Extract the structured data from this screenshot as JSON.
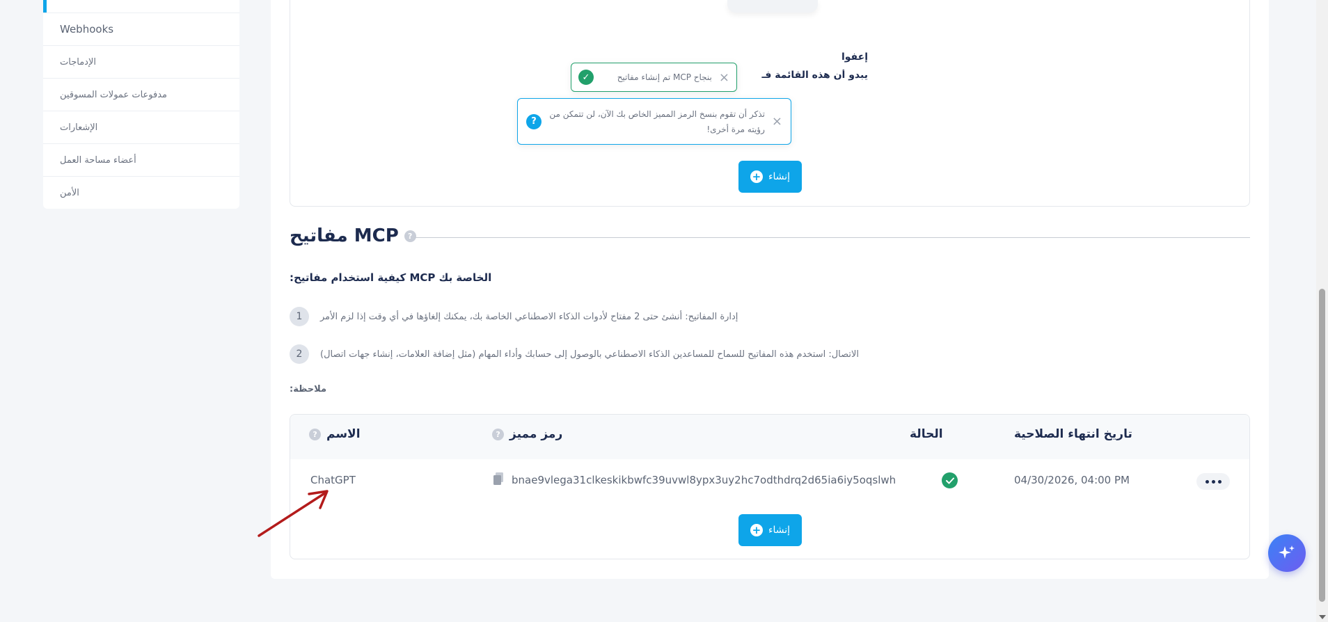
{
  "sidebar": {
    "active_label": "",
    "items": [
      {
        "label": "Webhooks"
      },
      {
        "label": "الإدماجات"
      },
      {
        "label": "مدفوعات عمولات المسوقين"
      },
      {
        "label": "الإشعارات"
      },
      {
        "label": "أعضاء مساحة العمل"
      },
      {
        "label": "الأمن"
      }
    ]
  },
  "empty_state": {
    "title": "إعفوا",
    "subtitle": "يبدو أن هذه القائمة فـ",
    "create_label": "إنشاء"
  },
  "toasts": {
    "success": "بنجاح MCP تم إنشاء مفاتيح",
    "info": "تذكر أن تقوم بنسخ الرمز المميز الخاص بك الآن، لن تتمكن من رؤيته مرة أخرى!"
  },
  "mcp": {
    "section_title": "مفاتيح MCP",
    "howto_title": "الخاصة بك MCP كيفية استخدام مفاتيح:",
    "steps": [
      {
        "num": "1",
        "text": "إدارة المفاتيح: أنشئ حتى 2 مفتاح لأدوات الذكاء الاصطناعي الخاصة بك، يمكنك إلغاؤها في أي وقت إذا لزم الأمر"
      },
      {
        "num": "2",
        "text": "الاتصال: استخدم هذه المفاتيح للسماح للمساعدين الذكاء الاصطناعي بالوصول إلى حسابك وأداء المهام (مثل إضافة العلامات، إنشاء جهات اتصال)"
      }
    ],
    "note": "ملاحظة:",
    "table": {
      "headers": {
        "name": "الاسم",
        "token": "رمز مميز",
        "status": "الحالة",
        "expiry": "تاريخ انتهاء الصلاحية"
      },
      "rows": [
        {
          "name": "ChatGPT",
          "token": "bnae9vlega31clkeskikbwfc39uvwl8ypx3uy2hc7odthdrq2d65ia6iy5oqslwh",
          "status": "active",
          "expiry": "04/30/2026, 04:00 PM"
        }
      ]
    },
    "create_label": "إنشاء"
  },
  "colors": {
    "accent": "#0ea5e9",
    "success": "#22a06b",
    "heading": "#1d2b4f",
    "annotation": "#b31b1b"
  }
}
